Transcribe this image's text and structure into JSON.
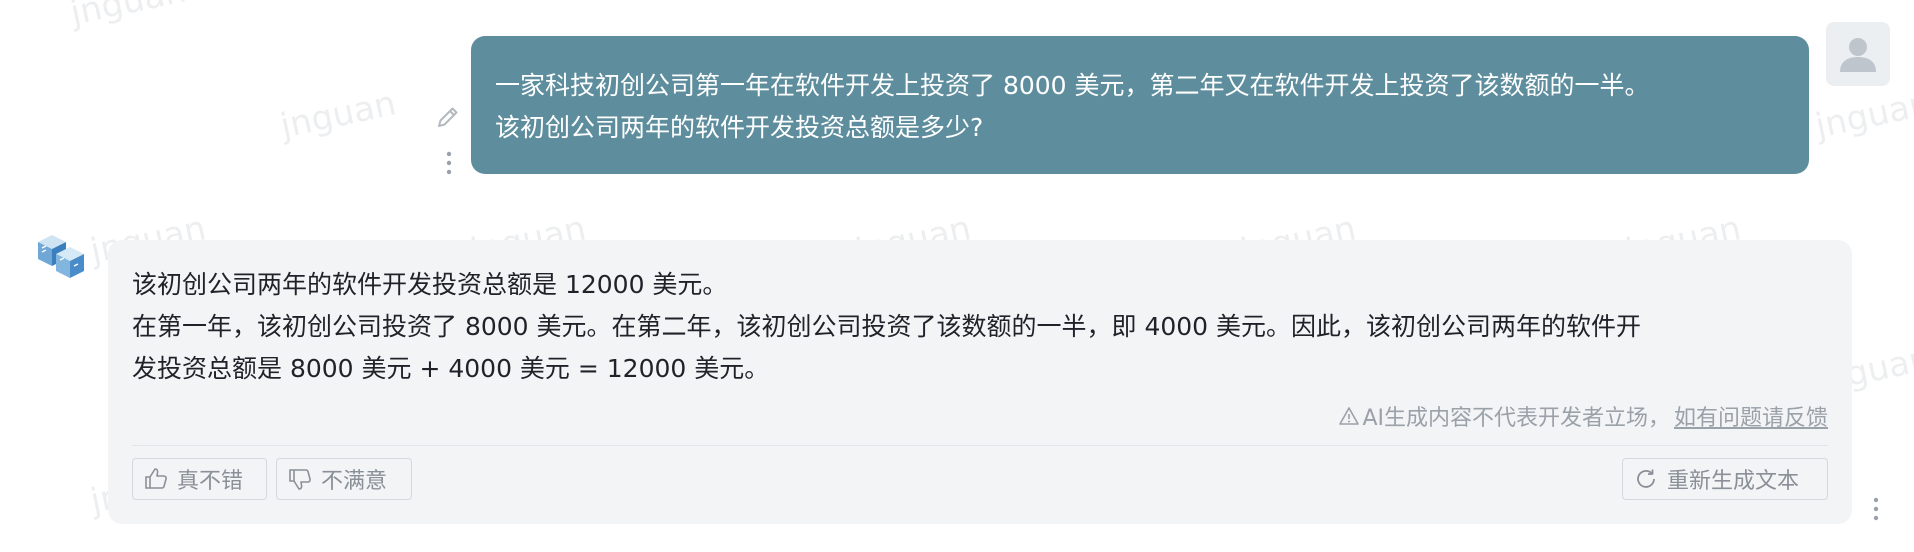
{
  "watermark": {
    "text": "jnguan"
  },
  "user_message": {
    "lines": [
      "一家科技初创公司第一年在软件开发上投资了 8000 美元，第二年又在软件开发上投资了该数额的一半。",
      "该初创公司两年的软件开发投资总额是多少?"
    ],
    "bubble_color": "#5e8e9e",
    "avatar_icon": "user-avatar-icon",
    "edit_icon": "pencil-icon",
    "more_icon": "more-vertical-icon"
  },
  "bot_message": {
    "avatar_icon": "cube-logo-icon",
    "lines": [
      "该初创公司两年的软件开发投资总额是 12000 美元。",
      "在第一年，该初创公司投资了 8000 美元。在第二年，该初创公司投资了该数额的一半，即 4000 美元。因此，该初创公司两年的软件开",
      "发投资总额是 8000 美元 + 4000 美元 = 12000 美元。"
    ],
    "disclaimer": {
      "icon": "warning-icon",
      "text": "AI生成内容不代表开发者立场，",
      "feedback_link": "如有问题请反馈"
    },
    "actions": {
      "like_label": "真不错",
      "like_icon": "thumbs-up-icon",
      "dislike_label": "不满意",
      "dislike_icon": "thumbs-down-icon",
      "regenerate_label": "重新生成文本",
      "regenerate_icon": "refresh-icon"
    },
    "more_icon": "more-vertical-icon"
  }
}
